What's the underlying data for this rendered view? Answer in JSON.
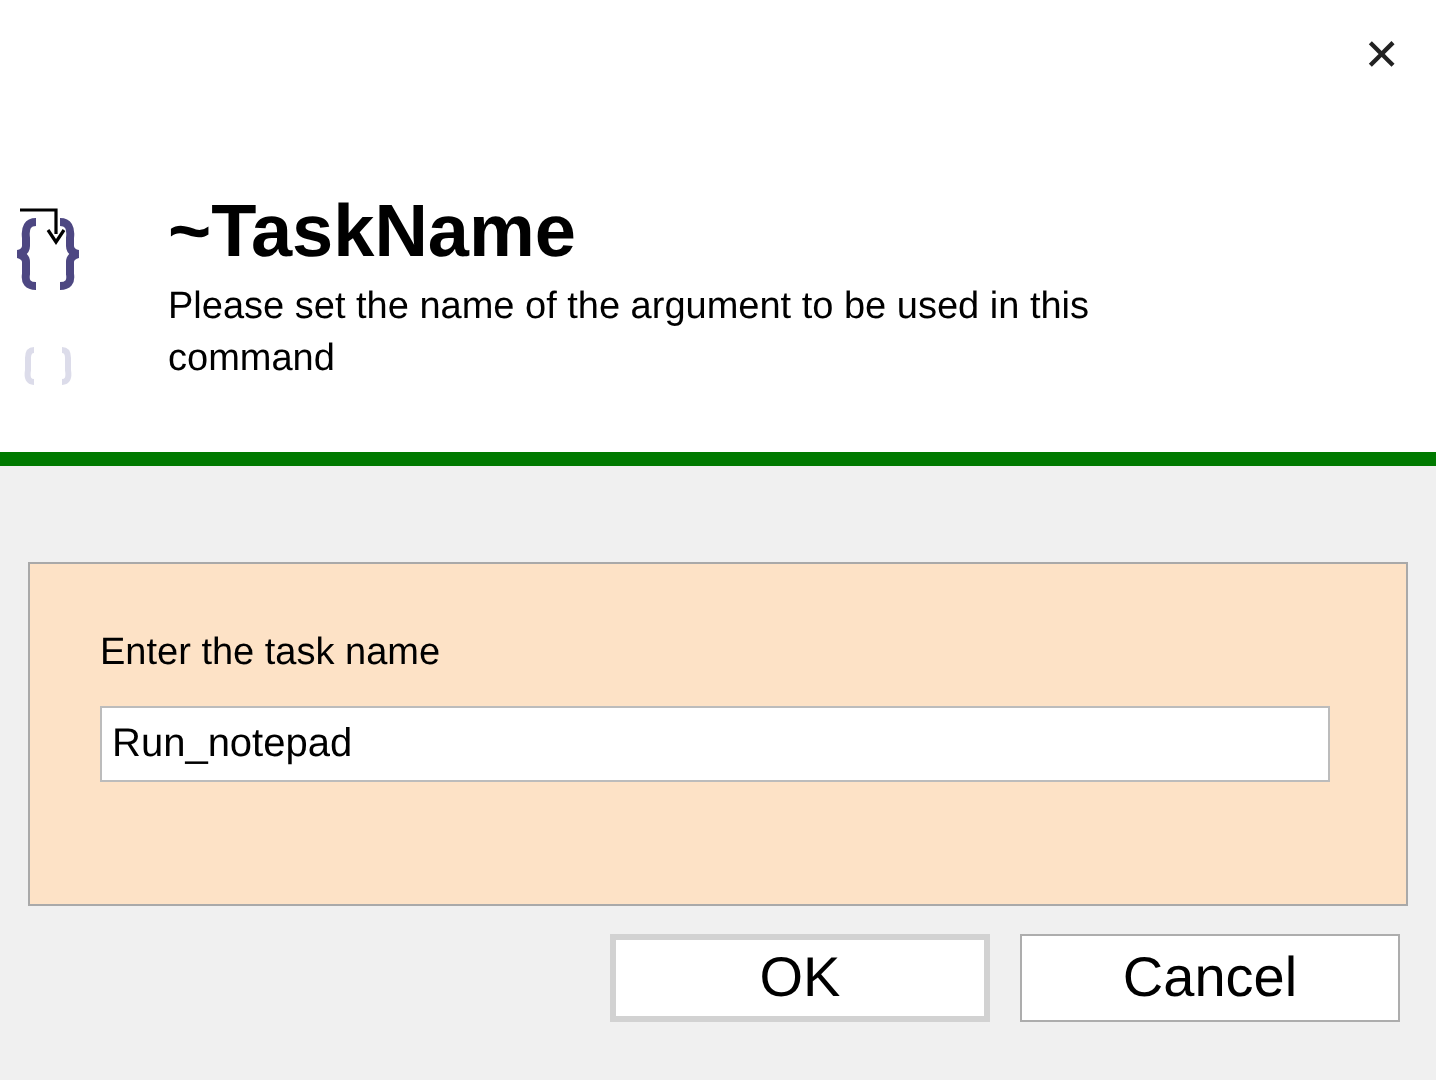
{
  "window": {
    "close": "✕"
  },
  "header": {
    "title": "~TaskName",
    "description": "Please set the name of the argument to be used in this command"
  },
  "form": {
    "label": "Enter the task name",
    "value": "Run_notepad"
  },
  "buttons": [
    {
      "label": "OK",
      "default": true
    },
    {
      "label": "Cancel",
      "default": false
    }
  ]
}
